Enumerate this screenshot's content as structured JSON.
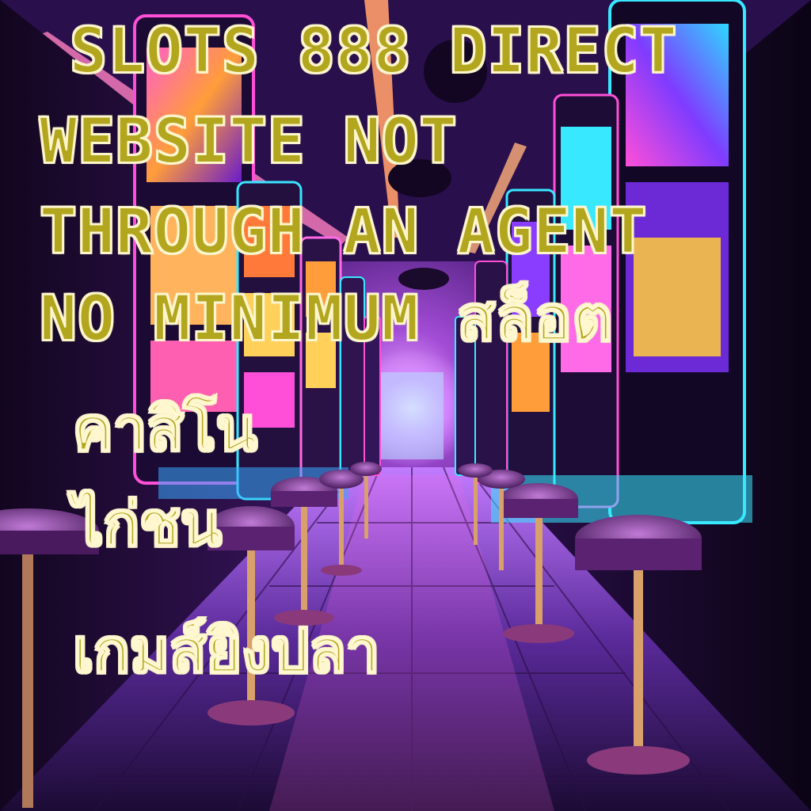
{
  "headline": {
    "line1": "SLOTS 888 DIRECT",
    "line2": "WEBSITE NOT",
    "line3": "THROUGH AN AGENT",
    "line4": "NO MINIMUM สล็อต"
  },
  "thai_lines": {
    "line1": "คาสิโน",
    "line2": "ไก่ชน",
    "line3": "เกมส์ยิงปลา"
  },
  "colors": {
    "text_fill": "#b3a61f",
    "text_outline": "#fff7d0",
    "neon_pink": "#ff4fd8",
    "neon_cyan": "#38e8ff",
    "neon_purple": "#8a3cff"
  }
}
